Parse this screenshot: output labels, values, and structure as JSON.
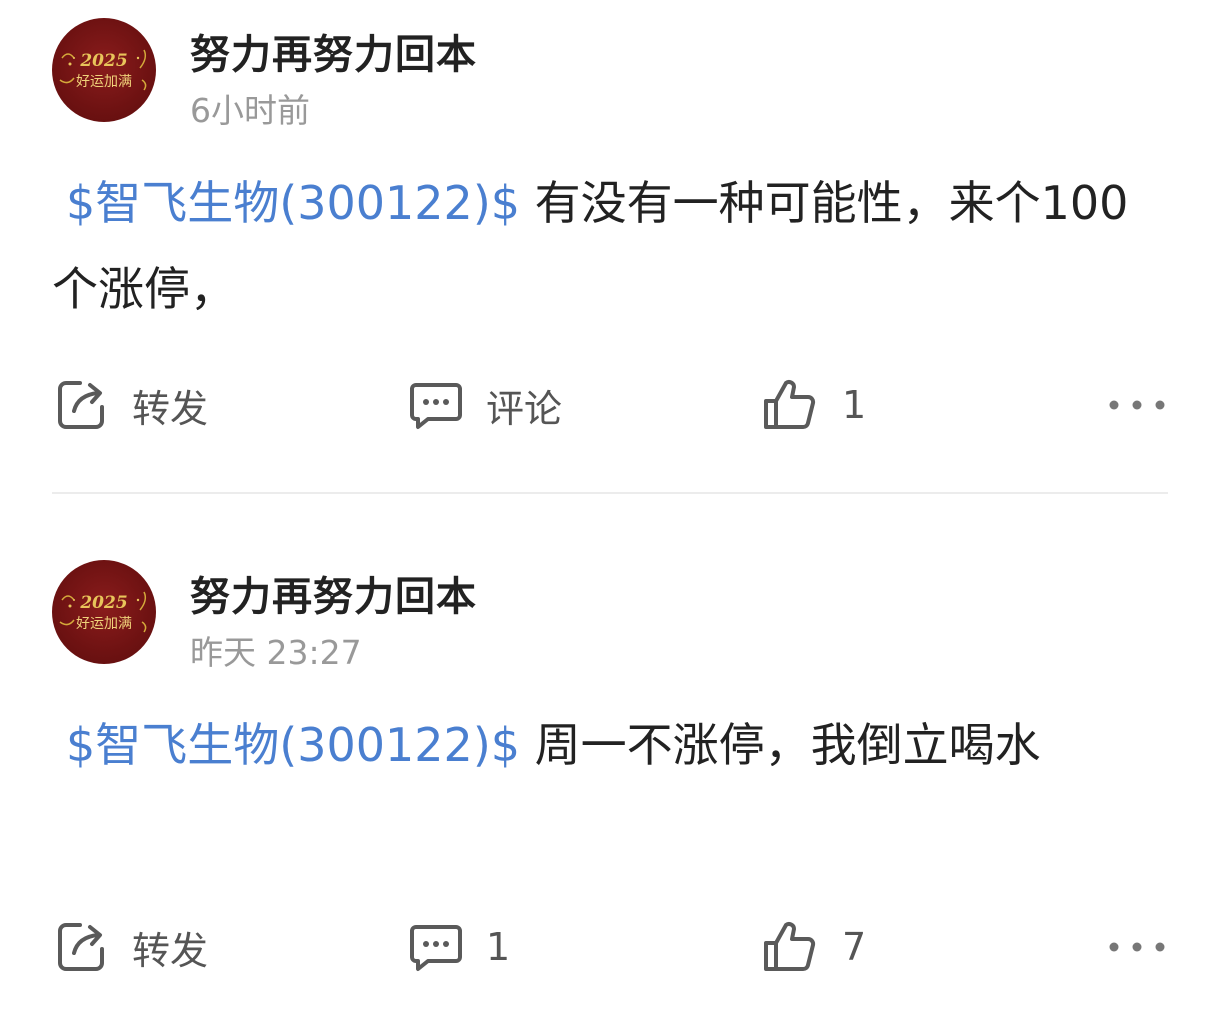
{
  "posts": [
    {
      "author": "努力再努力回本",
      "avatar_text": "2025 好运加满",
      "time": "6小时前",
      "stock_tag": "$智飞生物(300122)$",
      "text": " 有没有一种可能性，来个100个涨停，",
      "actions": {
        "share_label": "转发",
        "comment_label": "评论",
        "like_count": "1"
      }
    },
    {
      "author": "努力再努力回本",
      "avatar_text": "2025 好运加满",
      "time": "昨天 23:27",
      "stock_tag": "$智飞生物(300122)$",
      "text": " 周一不涨停，我倒立喝水",
      "actions": {
        "share_label": "转发",
        "comment_label": "1",
        "like_count": "7"
      }
    }
  ],
  "colors": {
    "stock_tag": "#4a7fd0",
    "avatar_bg": "#6e1212",
    "muted_text": "#999999",
    "icon": "#555555"
  },
  "icons": [
    "share-icon",
    "comment-icon",
    "thumbs-up-icon",
    "more-icon"
  ]
}
